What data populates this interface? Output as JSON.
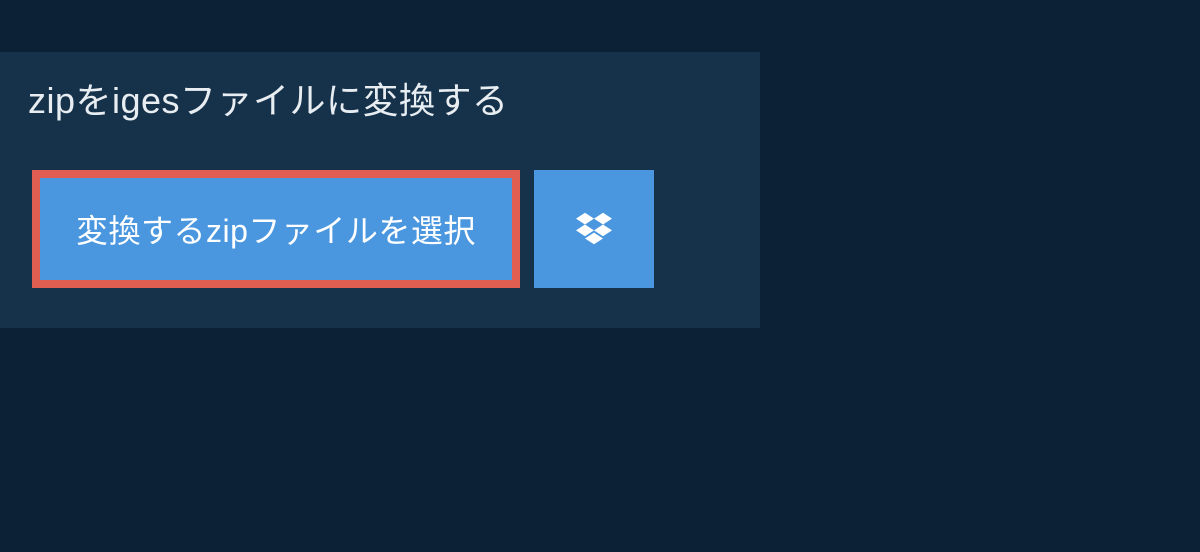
{
  "header": {
    "title": "zipをigesファイルに変換する"
  },
  "actions": {
    "select_file_label": "変換するzipファイルを選択"
  },
  "colors": {
    "background": "#0d2136",
    "panel": "#16324b",
    "button": "#4a97e0",
    "highlight_border": "#e05d52",
    "text_light": "#e8edf2",
    "text_white": "#ffffff"
  }
}
